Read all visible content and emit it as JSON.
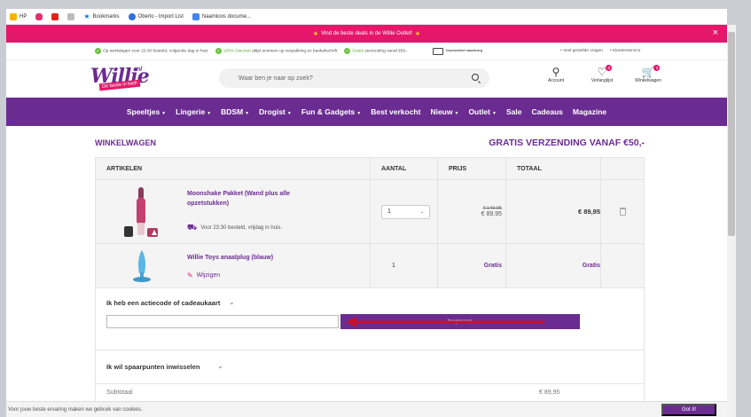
{
  "bookmarks": [
    {
      "label": "HP",
      "color": "#f4b400"
    },
    {
      "label": "",
      "color": "#e1306c"
    },
    {
      "label": "",
      "color": "#e62117"
    },
    {
      "label": "",
      "color": "#999999"
    },
    {
      "label": "Bookmarks",
      "color": "#1a73e8"
    },
    {
      "label": "Oberlo - Import List",
      "color": "#2f6fdf"
    },
    {
      "label": "Naamloos docume...",
      "color": "#4285f4"
    }
  ],
  "promo": {
    "text": "Vind de beste deals in de Willie Outlet!",
    "close": "×"
  },
  "usp": {
    "item1": "Op werkdagen voor 23:30 besteld, volgende dag in huis",
    "item2_green": "100% Discreet",
    "item2": "altijd anoniem op verpakking en bankafschrift",
    "item3_green": "Gratis",
    "item3": "verzending vanaf €50,-",
    "thuiswinkel": "thuiswinkel waarborg",
    "right1": "Veel gestelde vragen",
    "right2": "Klantenservice"
  },
  "header": {
    "logo_word": "Willie",
    "logo_suffix": "nl",
    "logo_tag": "De beste in bed!",
    "search_placeholder": "Waar ben je naar op zoek?",
    "account": "Account",
    "wishlist": "Verlanglijst",
    "wishlist_count": "0",
    "cart": "Winkelwagen",
    "cart_count": "2"
  },
  "nav": [
    "Speeltjes",
    "Lingerie",
    "BDSM",
    "Drogist",
    "Fun & Gadgets",
    "Best verkocht",
    "Nieuw",
    "Outlet",
    "Sale",
    "Cadeaus",
    "Magazine"
  ],
  "nav_dropdown": [
    true,
    true,
    true,
    true,
    true,
    false,
    true,
    true,
    false,
    false,
    false
  ],
  "page": {
    "title": "WINKELWAGEN",
    "shipping": "GRATIS VERZENDING VANAF €50,-"
  },
  "cart": {
    "columns": [
      "ARTIKELEN",
      "AANTAL",
      "PRIJS",
      "TOTAAL"
    ],
    "items": [
      {
        "name": "Moonshake Pakket (Wand plus alle opzetstukken)",
        "delivery": "Voor 23:30 besteld, vrijdag in huis.",
        "qty": "1",
        "old_price": "€ 149.95",
        "price": "€ 89.95",
        "total": "€ 89,95"
      },
      {
        "name": "Willie Toys anaalplug (blauw)",
        "edit": "Wijzigen",
        "qty": "1",
        "price": "Gratis",
        "total": "Gratis"
      }
    ]
  },
  "coupon": {
    "label": "Ik heb een actiecode of cadeaukaart",
    "button": "toepassen"
  },
  "points": {
    "label": "Ik wil spaarpunten inwisselen"
  },
  "subtotal": {
    "label": "Subtotaal",
    "value": "€ 89,95"
  },
  "cookie": {
    "text": "Voor jouw beste ervaring maken we gebruik van cookies.",
    "button": "Got it!"
  },
  "colors": {
    "brand_purple": "#6b2c91",
    "brand_pink": "#e5176a",
    "annotation_arrow": "#c8102e"
  }
}
